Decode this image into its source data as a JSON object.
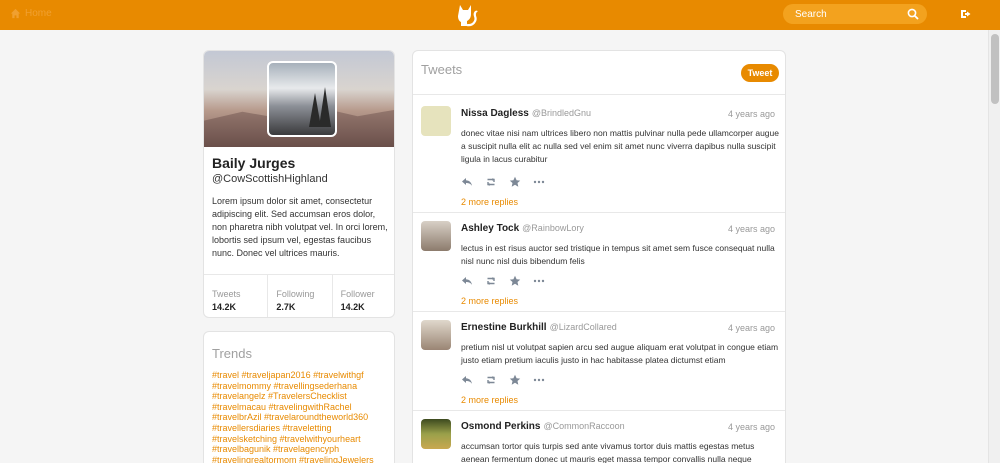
{
  "app": {
    "home_label": "Home",
    "brand_color": "#e88a00",
    "search_placeholder": "Search"
  },
  "profile": {
    "name": "Baily Jurges",
    "handle": "@CowScottishHighland",
    "bio": "Lorem ipsum dolor sit amet, consectetur adipiscing elit. Sed accumsan eros dolor, non pharetra nibh volutpat vel. In orci lorem, lobortis sed ipsum vel, egestas faucibus nunc. Donec vel ultrices mauris.",
    "stats": [
      {
        "label": "Tweets",
        "value": "14.2K"
      },
      {
        "label": "Following",
        "value": "2.7K"
      },
      {
        "label": "Follower",
        "value": "14.2K"
      }
    ]
  },
  "trends": {
    "title": "Trends",
    "tags": "#travel #traveljapan2016 #travelwithgf #travelmommy #travellingsederhana #travelangelz #TravelersChecklist #travelmacau #travelingwithRachel #travelbrAzil #travelaroundtheworld360 #travellersdiaries #traveletting #travelsketching #travelwithyourheart #travelbagunik #travelagencyph #travelingrealtormom #travelingJewelers"
  },
  "tweets": {
    "title": "Tweets",
    "tweet_button": "Tweet",
    "items": [
      {
        "name": "Nissa Dagless",
        "handle": "@BrindledGnu",
        "time": "4 years ago",
        "text": "donec vitae nisi nam ultrices libero non mattis pulvinar nulla pede ullamcorper augue a suscipit nulla elit ac nulla sed vel enim sit amet nunc viverra dapibus nulla suscipit ligula in lacus curabitur",
        "more": "2 more replies",
        "avatar_color": "#e6e3bd"
      },
      {
        "name": "Ashley Tock",
        "handle": "@RainbowLory",
        "time": "4 years ago",
        "text": "lectus in est risus auctor sed tristique in tempus sit amet sem fusce consequat nulla nisl nunc nisl duis bibendum felis",
        "more": "2 more replies",
        "avatar_color": "#8c7b6c"
      },
      {
        "name": "Ernestine Burkhill",
        "handle": "@LizardCollared",
        "time": "4 years ago",
        "text": "pretium nisl ut volutpat sapien arcu sed augue aliquam erat volutpat in congue etiam justo etiam pretium iaculis justo in hac habitasse platea dictumst etiam",
        "more": "2 more replies",
        "avatar_color": "#9a8574"
      },
      {
        "name": "Osmond Perkins",
        "handle": "@CommonRaccoon",
        "time": "4 years ago",
        "text": "accumsan tortor quis turpis sed ante vivamus tortor duis mattis egestas metus aenean fermentum donec ut mauris eget massa tempor convallis nulla neque",
        "more": "",
        "avatar_color": "#7a8a3a"
      }
    ]
  }
}
